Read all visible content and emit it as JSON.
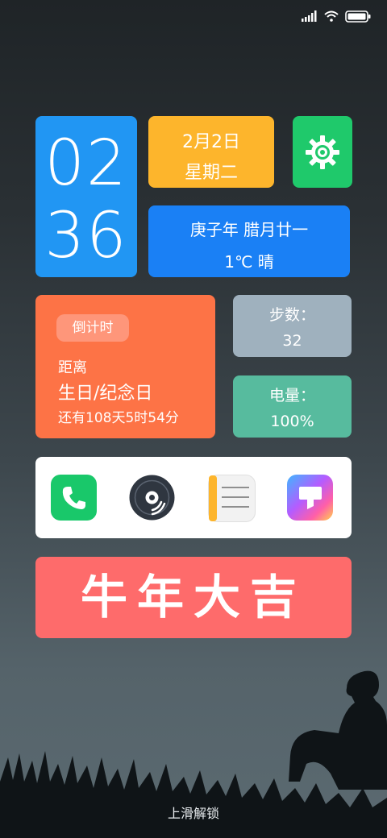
{
  "status_bar": {
    "icons": [
      "signal-icon",
      "wifi-icon",
      "battery-icon"
    ]
  },
  "clock": {
    "hour": "02",
    "minute": "36"
  },
  "date": {
    "date": "2月2日",
    "weekday": "星期二"
  },
  "lunar": {
    "lunar_date": "庚子年 腊月廿一",
    "weather": "1℃  晴"
  },
  "countdown": {
    "chip_label": "倒计时",
    "line1": "距离",
    "line2": "生日/纪念日",
    "line3": "还有108天5时54分"
  },
  "steps": {
    "label": "步数：",
    "value": "32"
  },
  "battery": {
    "label": "电量：",
    "value": "100%"
  },
  "dock": {
    "apps": [
      "phone-icon",
      "music-icon",
      "notes-icon",
      "themes-icon"
    ]
  },
  "banner": {
    "text": "牛年大吉"
  },
  "unlock_hint": "上滑解锁",
  "colors": {
    "clock_bg": "#2196f3",
    "date_bg": "#fdb52c",
    "settings_bg": "#1fc96b",
    "lunar_bg": "#1a80f5",
    "countdown_bg": "#fd7346",
    "steps_bg": "#9fb1be",
    "battery_bg": "#57bb9e",
    "banner_bg": "#fe6b6b"
  }
}
